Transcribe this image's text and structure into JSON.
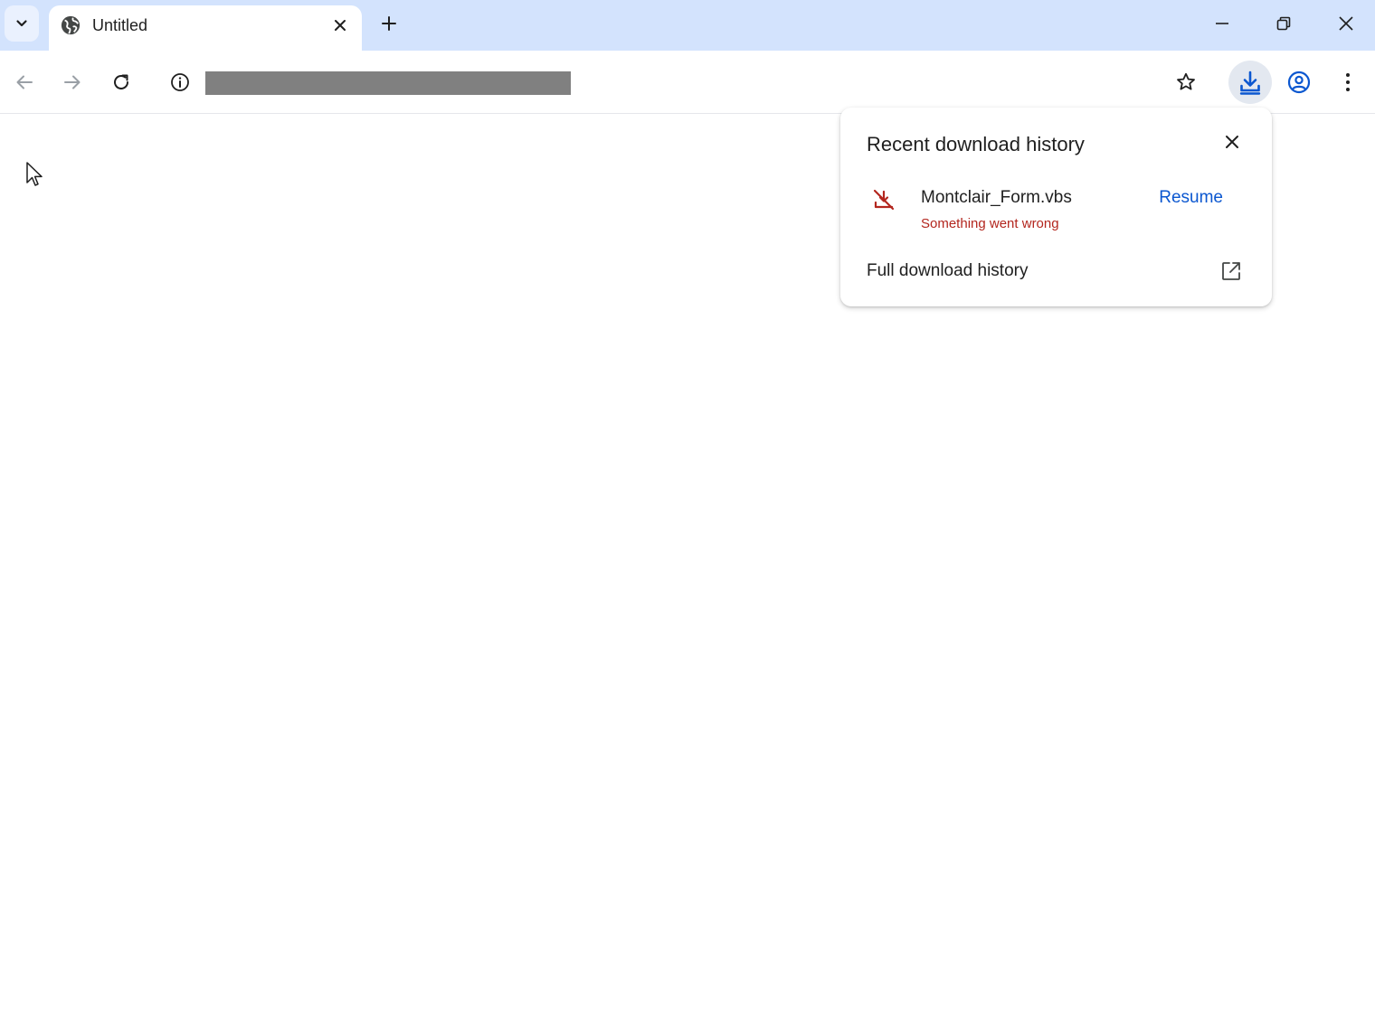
{
  "tabs": [
    {
      "title": "Untitled"
    }
  ],
  "address_bar": {
    "url": ""
  },
  "download_bubble": {
    "title": "Recent download history",
    "item": {
      "filename": "Montclair_Form.vbs",
      "status": "Something went wrong",
      "action": "Resume"
    },
    "footer": "Full download history"
  },
  "colors": {
    "tabstrip_bg": "#d3e3fd",
    "error_red": "#b3261e",
    "link_blue": "#0b57d0",
    "download_icon_blue": "#0b57d0"
  },
  "icons": {
    "tab_search": "chevron-down-icon",
    "favicon": "globe-icon",
    "tab_close": "close-icon",
    "new_tab": "plus-icon",
    "minimize": "minimize-icon",
    "restore": "restore-icon",
    "window_close": "close-icon",
    "back": "arrow-left-icon",
    "forward": "arrow-right-icon",
    "reload": "reload-icon",
    "site_info": "info-icon",
    "bookmark": "star-icon",
    "downloads": "download-icon",
    "profile": "account-circle-icon",
    "menu": "kebab-menu-icon",
    "download_error": "download-failed-icon",
    "open_external": "open-in-new-icon"
  }
}
